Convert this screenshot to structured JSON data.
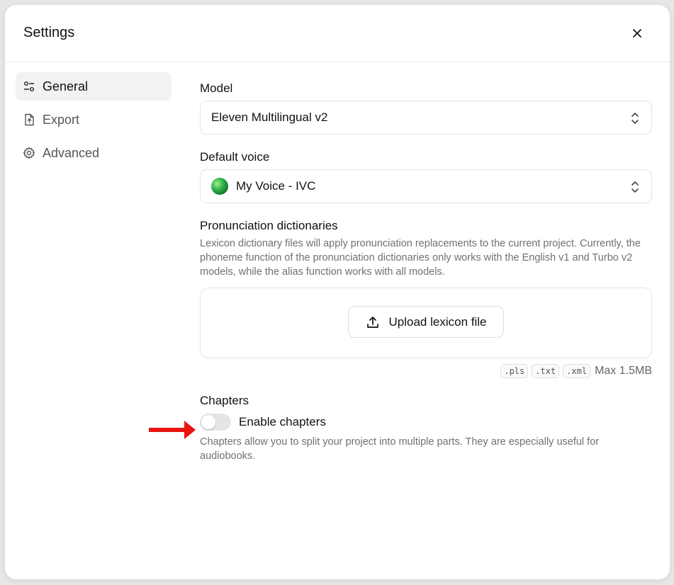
{
  "modal": {
    "title": "Settings"
  },
  "sidebar": {
    "items": [
      {
        "label": "General",
        "icon": "sliders-icon",
        "active": true
      },
      {
        "label": "Export",
        "icon": "file-export-icon",
        "active": false
      },
      {
        "label": "Advanced",
        "icon": "gear-icon",
        "active": false
      }
    ]
  },
  "general": {
    "model": {
      "label": "Model",
      "value": "Eleven Multilingual v2"
    },
    "voice": {
      "label": "Default voice",
      "value": "My Voice - IVC"
    },
    "pronunciation": {
      "label": "Pronunciation dictionaries",
      "description": "Lexicon dictionary files will apply pronunciation replacements to the current project. Currently, the phoneme function of the pronunciation dictionaries only works with the English v1 and Turbo v2 models, while the alias function works with all models.",
      "upload_label": "Upload lexicon file",
      "formats": [
        ".pls",
        ".txt",
        ".xml"
      ],
      "max_size": "Max 1.5MB"
    },
    "chapters": {
      "label": "Chapters",
      "toggle_label": "Enable chapters",
      "enabled": false,
      "description": "Chapters allow you to split your project into multiple parts. They are especially useful for audiobooks."
    }
  },
  "colors": {
    "annotation_arrow": "#e8150f",
    "toggle_off": "#e5e5e5"
  }
}
